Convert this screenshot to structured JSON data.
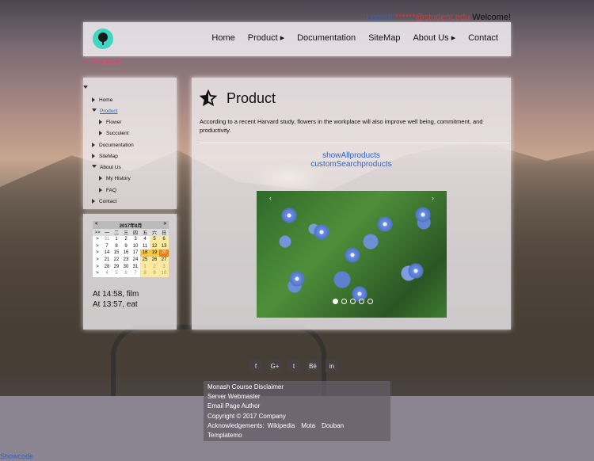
{
  "topbar": {
    "logout": "Logout",
    "email": "******@student.edu",
    "welcome": "Welcome!"
  },
  "nav": {
    "home": "Home",
    "product": "Product",
    "documentation": "Documentation",
    "sitemap": "SiteMap",
    "about": "About Us",
    "contact": "Contact"
  },
  "breadcrumb": "> Product",
  "sidebar": {
    "items": [
      "Home",
      "Product",
      "Flower",
      "Succulent",
      "Documentation",
      "SiteMap",
      "About Us",
      "My History",
      "FAQ",
      "Contact"
    ]
  },
  "calendar": {
    "prev": "<",
    "next": ">",
    "month": "2017年8月",
    "weekdays": [
      ">>",
      "一",
      "二",
      "三",
      "四",
      "五",
      "六",
      "日"
    ],
    "weeks": [
      [
        ">",
        "31",
        "1",
        "2",
        "3",
        "4",
        "5",
        "6"
      ],
      [
        ">",
        "7",
        "8",
        "9",
        "10",
        "11",
        "12",
        "13"
      ],
      [
        ">",
        "14",
        "15",
        "16",
        "17",
        "18",
        "19",
        "20"
      ],
      [
        ">",
        "21",
        "22",
        "23",
        "24",
        "25",
        "26",
        "27"
      ],
      [
        ">",
        "28",
        "29",
        "30",
        "31",
        "1",
        "2",
        "3"
      ],
      [
        ">",
        "4",
        "5",
        "6",
        "7",
        "8",
        "9",
        "10"
      ]
    ]
  },
  "events": [
    "At 14:58, film",
    "At 13:57, eat"
  ],
  "main": {
    "title": "Product",
    "description": "According to a recent Harvard study, flowers in the workplace will also improve well being, commitment, and productivity.",
    "links": [
      "showAllproducts",
      "customSearchproducts"
    ]
  },
  "slider": {
    "prev": "‹",
    "next": "›",
    "dots": 5,
    "active": 0
  },
  "social": [
    "f",
    "G+",
    "t",
    "Bē",
    "in"
  ],
  "footer": {
    "line1": "Monash Course Disclaimer",
    "line2": "Server Webmaster",
    "line3": "Email Page Author",
    "line4": "Copyright © 2017 Company",
    "ack_label": "Acknowledgements:",
    "ack": [
      "Wikipedia",
      "Mota",
      "Douban"
    ],
    "line6": "Templatemo"
  },
  "showcode": "Showcode"
}
